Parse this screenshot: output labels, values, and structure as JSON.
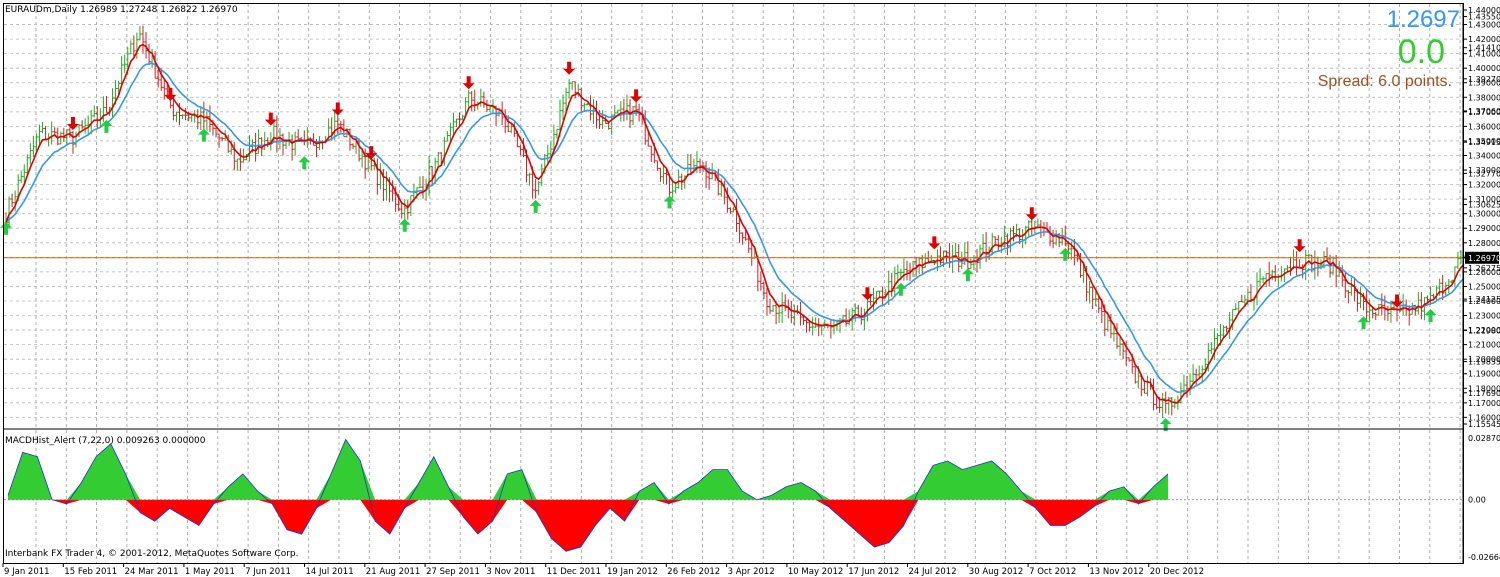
{
  "window": {
    "symbol_header": "EURAUDm,Daily  1.26989 1.27248 1.26822 1.26970",
    "current_price": "1.2697",
    "profit": "0.0",
    "spread": "Spread: 6.0 points.",
    "copyright": "Interbank FX Trader 4, © 2001-2012, MetaQuotes Software Corp.",
    "indicator_header": "MACDHist_Alert (7,22,0)  0.009263 0.000000"
  },
  "colors": {
    "up_candle": "#22aa22",
    "down_candle": "#cc2222",
    "fast_ma": "#e00000",
    "slow_ma": "#3399ee",
    "price_line": "#e06010",
    "hist_positive": "#33cc33",
    "hist_negative": "#ff0000",
    "buy_arrow": "#22cc44",
    "sell_arrow": "#e00000",
    "price_big": "#3399ee",
    "profit_big": "#33cc33",
    "spread_text": "#a05020"
  },
  "chart_data": [
    {
      "type": "line",
      "name": "price",
      "x": [
        "9 Jan 2011",
        "15 Feb 2011",
        "24 Mar 2011",
        "1 May 2011",
        "7 Jun 2011",
        "14 Jul 2011",
        "21 Aug 2011",
        "27 Sep 2011",
        "3 Nov 2011",
        "11 Dec 2011",
        "19 Jan 2012",
        "26 Feb 2012",
        "3 Apr 2012",
        "10 May 2012",
        "17 Jun 2012",
        "24 Jul 2012",
        "30 Aug 2012",
        "7 Oct 2012",
        "13 Nov 2012",
        "20 Dec 2012"
      ],
      "price_series": [
        1.3,
        1.355,
        1.352,
        1.37,
        1.425,
        1.372,
        1.364,
        1.336,
        1.355,
        1.345,
        1.362,
        1.332,
        1.302,
        1.335,
        1.38,
        1.367,
        1.315,
        1.39,
        1.362,
        1.371,
        1.318,
        1.335,
        1.3,
        1.24,
        1.225,
        1.22,
        1.235,
        1.258,
        1.27,
        1.268,
        1.282,
        1.29,
        1.282,
        1.232,
        1.19,
        1.165,
        1.195,
        1.228,
        1.258,
        1.268,
        1.265,
        1.235,
        1.23,
        1.24,
        1.271
      ],
      "y_ticks": [
        "1.44000",
        "1.43550",
        "1.43000",
        "1.42000",
        "1.41410",
        "1.41000",
        "1.40000",
        "1.39270",
        "1.39000",
        "1.38000",
        "1.37000",
        "1.37060",
        "1.36000",
        "1.35000",
        "1.34915",
        "1.34000",
        "1.33000",
        "1.32770",
        "1.32000",
        "1.31000",
        "1.30625",
        "1.30000",
        "1.29000",
        "1.28000",
        "1.27000",
        "1.26970",
        "1.26275",
        "1.26000",
        "1.25000",
        "1.24125",
        "1.24000",
        "1.23000",
        "1.21980",
        "1.22000",
        "1.21000",
        "1.20000",
        "1.19835",
        "1.19000",
        "1.18000",
        "1.17690",
        "1.17000",
        "1.16000",
        "1.15545"
      ],
      "ylim": [
        1.15545,
        1.44
      ],
      "current_price": 1.2697,
      "buy_signals": [
        0,
        3,
        6,
        9,
        12,
        16,
        20,
        27,
        29,
        32,
        35,
        41,
        43
      ],
      "sell_signals": [
        2,
        5,
        8,
        10,
        11,
        14,
        17,
        19,
        26,
        28,
        31,
        39,
        42
      ]
    },
    {
      "type": "area",
      "name": "MACDHist_Alert (7,22,0)",
      "y_ticks": [
        "0.028709",
        "0.00",
        "-0.026640"
      ],
      "ylim": [
        -0.02664,
        0.028709
      ],
      "values": [
        0.002,
        0.022,
        0.02,
        0.0,
        -0.002,
        0.008,
        0.02,
        0.026,
        0.012,
        -0.006,
        -0.01,
        -0.004,
        -0.008,
        -0.012,
        -0.002,
        0.006,
        0.012,
        0.004,
        -0.002,
        -0.014,
        -0.016,
        -0.004,
        0.012,
        0.028,
        0.018,
        -0.01,
        -0.016,
        -0.004,
        0.008,
        0.02,
        0.006,
        -0.008,
        -0.016,
        -0.01,
        0.012,
        0.014,
        -0.006,
        -0.018,
        -0.024,
        -0.022,
        -0.012,
        -0.004,
        -0.01,
        0.004,
        0.008,
        -0.002,
        0.004,
        0.008,
        0.014,
        0.014,
        0.004,
        0.0,
        0.002,
        0.006,
        0.008,
        0.004,
        -0.004,
        -0.01,
        -0.016,
        -0.022,
        -0.02,
        -0.012,
        0.004,
        0.016,
        0.018,
        0.014,
        0.016,
        0.018,
        0.012,
        0.004,
        -0.004,
        -0.012,
        -0.012,
        -0.008,
        -0.003,
        0.004,
        0.006,
        -0.002,
        0.006,
        0.012
      ]
    }
  ]
}
